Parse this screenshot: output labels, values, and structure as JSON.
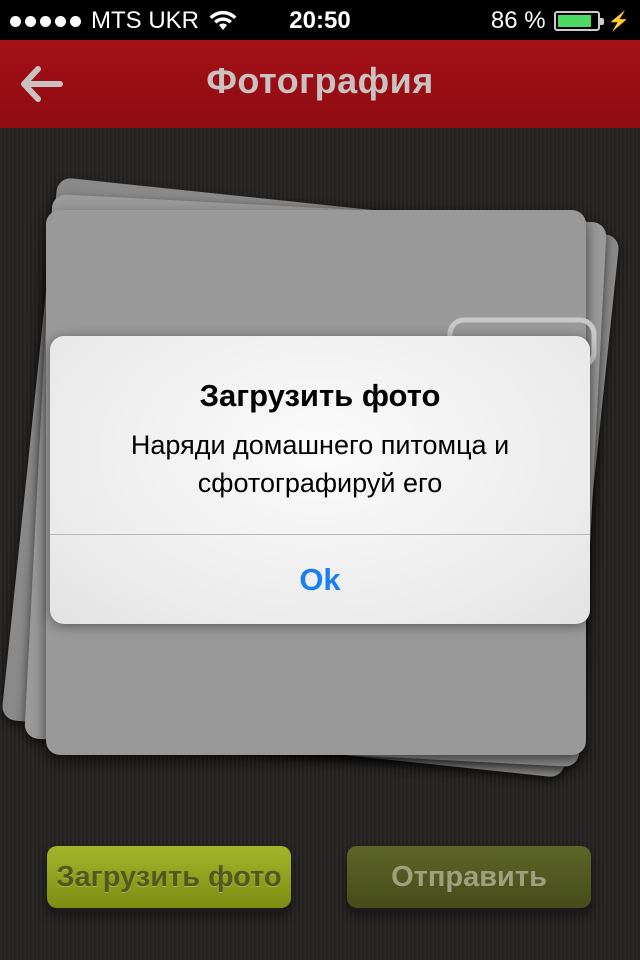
{
  "status_bar": {
    "carrier": "MTS UKR",
    "time": "20:50",
    "battery_percent": "86 %",
    "battery_level": 0.86
  },
  "nav": {
    "title": "Фотография",
    "back_icon": "arrow-left-icon"
  },
  "alert": {
    "title": "Загрузить фото",
    "message_line1": "Наряди домашнего питомца и",
    "message_line2": "сфотографируй его",
    "ok_label": "Ok",
    "ok_color": "#1a7ff0"
  },
  "buttons": {
    "upload_label": "Загрузить фото",
    "send_label": "Отправить"
  },
  "colors": {
    "nav_bar": "#9b0e15",
    "upload_button": "#8fa01e",
    "send_button": "#505920"
  }
}
